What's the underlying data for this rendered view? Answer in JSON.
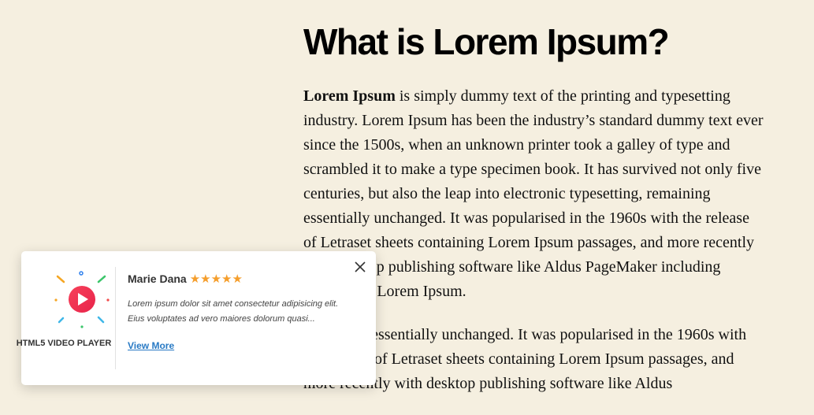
{
  "article": {
    "heading": "What is Lorem Ipsum?",
    "p1_bold": "Lorem Ipsum",
    "p1_rest": " is simply dummy text of the printing and typesetting industry. Lorem Ipsum has been the industry’s standard dummy text ever since the 1500s, when an unknown printer took a galley of type and scrambled it to make a type specimen book. It has survived not only five centuries, but also the leap into electronic typesetting, remaining essentially unchanged. It was popularised in the 1960s with the release of Letraset sheets containing Lorem Ipsum passages, and more recently with desktop publishing software like Aldus PageMaker including versions of Lorem Ipsum.",
    "p2": "remaining essentially unchanged. It was popularised in the 1960s with the release of Letraset sheets containing Lorem Ipsum passages, and more recently with desktop publishing software like Aldus"
  },
  "popup": {
    "logo_text": "HTML5 VIDEO PLAYER",
    "name": "Marie Dana",
    "stars": "★★★★★",
    "rating": 5,
    "message": "Lorem ipsum dolor sit amet consectetur adipisicing elit. Eius voluptates ad vero maiores dolorum quasi...",
    "view_more": "View More",
    "colors": {
      "play_gradient_start": "#f7405a",
      "play_gradient_end": "#e8244a",
      "star": "#f59e2c",
      "link": "#2779c4"
    }
  }
}
